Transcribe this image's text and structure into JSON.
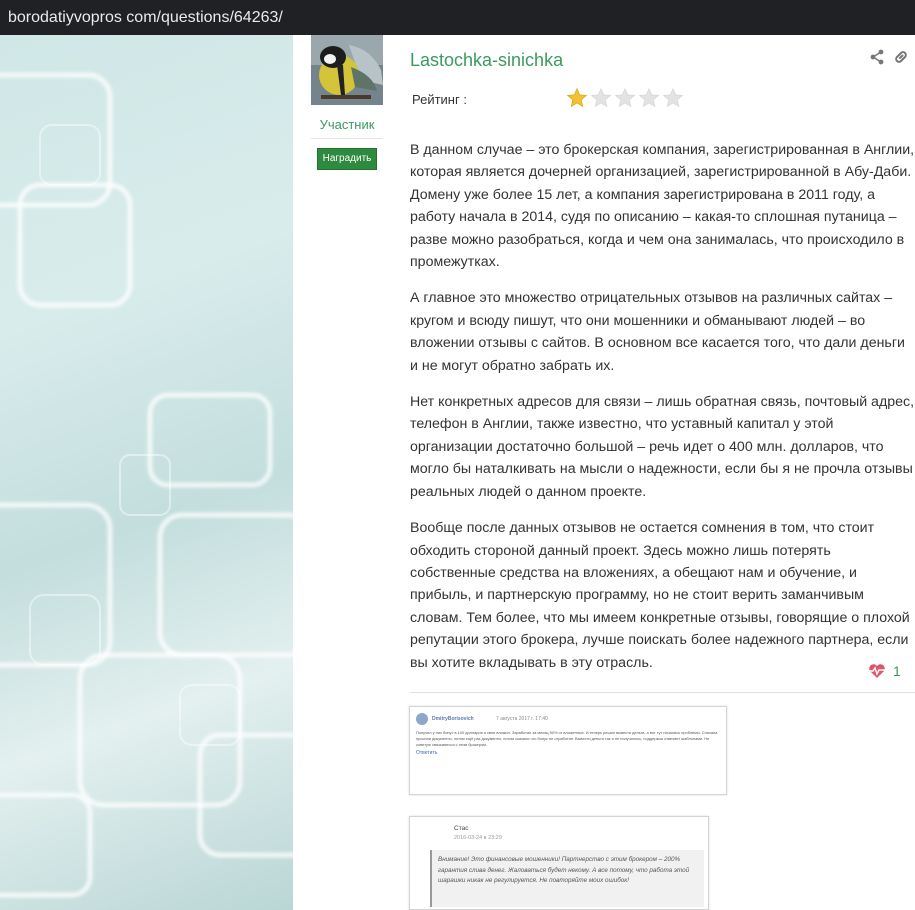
{
  "browser": {
    "url": "borodatiyvopros com/questions/64263/"
  },
  "author": {
    "name": "Lastochka-sinichka",
    "role": "Участник",
    "award_button": "Наградить"
  },
  "rating": {
    "label": "Рейтинг :",
    "value": 1,
    "max": 5,
    "filled_color": "#f2c230",
    "empty_color": "#e3e3e3"
  },
  "post": {
    "paragraphs": [
      "В данном случае – это брокерская компания, зарегистрированная в Англии, которая является дочерней организацией, зарегистрированной в Абу-Даби. Домену уже более 15 лет, а компания зарегистрирована в 2011 году, а работу начала в 2014, судя по описанию – какая-то сплошная путаница – разве можно разобраться, когда и чем она занималась, что происходило в промежутках.",
      "А главное это множество отрицательных отзывов на различных сайтах – кругом и всюду пишут, что они мошенники и обманывают людей – во вложении отзывы с сайтов. В основном все касается того, что дали деньги и не могут обратно забрать их.",
      "Нет конкретных адресов для связи – лишь обратная связь, почтовый адрес, телефон в Англии, также известно, что уставный капитал у этой организации достаточно большой – речь идет о 400 млн. долларов, что могло бы наталкивать на мысли о надежности, если бы я не прочла отзывы реальных людей о данном проекте.",
      "Вообще после данных отзывов не остается сомнения в том, что стоит обходить стороной данный проект. Здесь можно лишь потерять собственные средства на вложениях, а обещают нам и обучение, и прибыль, и партнерскую программу, но не стоит верить заманчивым словам. Тем более, что мы имеем конкретные отзывы, говорящие о плохой репутации этого брокера, лучше поискать более надежного партнера, если вы хотите вкладывать в эту отрасль."
    ],
    "likes": "1"
  },
  "icons": {
    "share": "share-icon",
    "link": "link-icon",
    "like": "heart-pulse-icon"
  },
  "colors": {
    "accent_green": "#3c9a5f",
    "award_green": "#2e8a3e",
    "heart_red": "#e0556a"
  },
  "attachments": {
    "review1": {
      "name": "DmitryBorisovich",
      "date": "7 августа 2017 г. 17:40",
      "text": "Получил у них бонус в 100 долларов и свои вложил. Заработал за месяц 50% от вложенных. И теперь решил вывести деньги, а вот тут начались проблемы. Сначала просили документы, потом ещё раз документы, потом сказали что бонус не отработан. Вывести деньги так и не получилось, поддержка отвечает шаблонами. Не советую связываться с этим брокером.",
      "link": "Ответить"
    },
    "review2": {
      "name": "Стас",
      "date": "2016-03-24 в 23:29",
      "text": "Внимание! Это финансовые мошенники! Партнерство с этим брокером – 200% гарантия слива денег. Жаловаться будет некому. А все потому, что работа этой шарашки никак не регулируется. Не повторяйте моих ошибок!"
    }
  }
}
